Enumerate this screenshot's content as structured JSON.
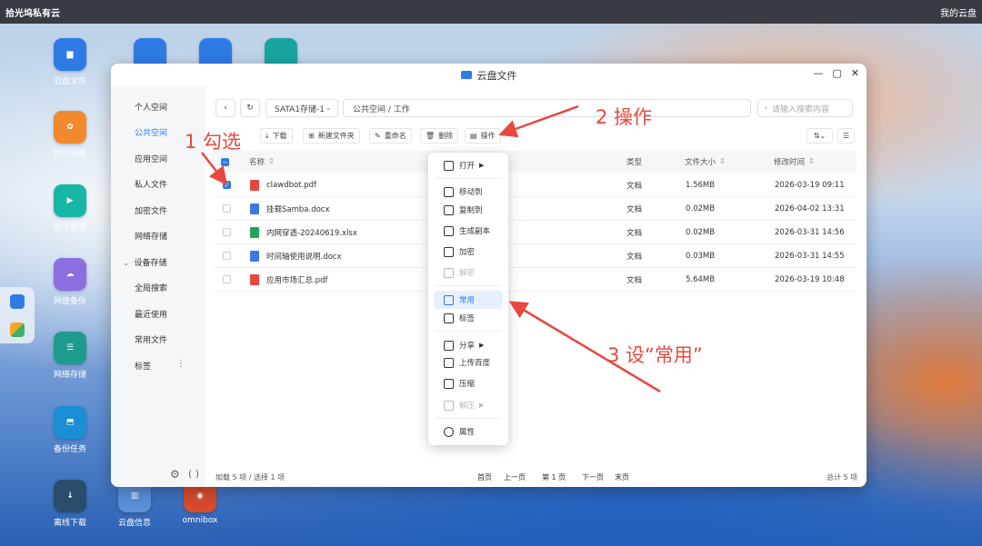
{
  "topbar": {
    "title": "拾光坞私有云",
    "user": "我的云盘"
  },
  "desktop": {
    "icons": [
      {
        "id": "yunpan",
        "label": "云盘文件",
        "glyph": "▆",
        "color": "#2f7be5"
      },
      {
        "id": "photo",
        "label": "拾光相册",
        "glyph": "✿",
        "color": "#f08a2c"
      },
      {
        "id": "video",
        "label": "拾光影视",
        "glyph": "▶",
        "color": "#18b6a6"
      },
      {
        "id": "backup",
        "label": "网盘备份",
        "glyph": "☁",
        "color": "#8b6fe0"
      },
      {
        "id": "netstore",
        "label": "网络存储",
        "glyph": "☰",
        "color": "#1d9b8f"
      },
      {
        "id": "task",
        "label": "备份任务",
        "glyph": "⬒",
        "color": "#1a8fd6"
      },
      {
        "id": "download",
        "label": "离线下载",
        "glyph": "↓",
        "color": "#2b4d6b"
      },
      {
        "id": "info",
        "label": "云盘信息",
        "glyph": "▥",
        "color": "#5b8fd8"
      },
      {
        "id": "omnibox",
        "label": "omnibox",
        "glyph": "◉",
        "color": "#d74a2c"
      }
    ]
  },
  "window": {
    "title": "云盘文件"
  },
  "sidebar": {
    "items": [
      "个人空间",
      "公共空间",
      "应用空间",
      "私人文件",
      "加密文件",
      "网络存储",
      "设备存储",
      "全局搜索",
      "最近使用",
      "常用文件",
      "标签"
    ]
  },
  "toolbar": {
    "storage_select": "SATA1存储-1",
    "path": "公共空间 / 工作",
    "search_placeholder": "请输入搜索内容",
    "download": "下载",
    "new_folder": "新建文件夹",
    "rename": "重命名",
    "delete": "删除",
    "operate": "操作"
  },
  "table": {
    "headers": {
      "name": "名称",
      "type": "类型",
      "size": "文件大小",
      "mtime": "修改时间"
    },
    "rows": [
      {
        "name": "clawdbot.pdf",
        "type": "文档",
        "size": "1.56MB",
        "mtime": "2026-03-19 09:11",
        "checked": true,
        "kind": "pdf"
      },
      {
        "name": "挂载Samba.docx",
        "type": "文档",
        "size": "0.02MB",
        "mtime": "2026-04-02 13:31",
        "checked": false,
        "kind": "docx"
      },
      {
        "name": "内网穿透-20240619.xlsx",
        "type": "文档",
        "size": "0.02MB",
        "mtime": "2026-03-31 14:56",
        "checked": false,
        "kind": "xlsx"
      },
      {
        "name": "时间轴使用说明.docx",
        "type": "文档",
        "size": "0.03MB",
        "mtime": "2026-03-31 14:55",
        "checked": false,
        "kind": "docx"
      },
      {
        "name": "应用市场汇总.pdf",
        "type": "文档",
        "size": "5.64MB",
        "mtime": "2026-03-19 10:48",
        "checked": false,
        "kind": "pdf"
      }
    ]
  },
  "colors": {
    "pdf": "#e5483f",
    "docx": "#3a7ae0",
    "xlsx": "#24a35a",
    "accent": "#2f7be5",
    "annotation": "#e8483f"
  },
  "footer": {
    "status": "加载 5 项 / 选择 1 项",
    "first": "首页",
    "prev": "上一页",
    "page": "第 1 页",
    "next": "下一页",
    "last": "末页",
    "total": "总计 5 项"
  },
  "context_menu": {
    "items": [
      "打开",
      "移动到",
      "复制到",
      "生成副本",
      "加密",
      "解密",
      "常用",
      "标签",
      "分享",
      "上传百度",
      "压缩",
      "解压",
      "属性"
    ]
  },
  "annotations": {
    "a1": "1 勾选",
    "a2": "2 操作",
    "a3": "3 设“常用”"
  }
}
